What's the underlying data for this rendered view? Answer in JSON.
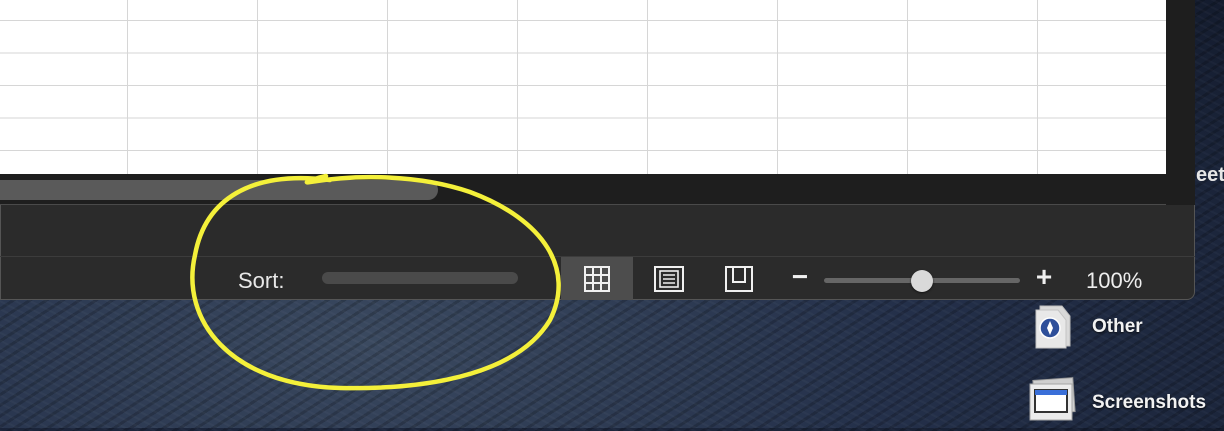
{
  "statusbar": {
    "sort_label": "Sort:",
    "view_buttons": [
      {
        "name": "normal-view",
        "icon": "grid-icon",
        "active": true
      },
      {
        "name": "page-layout-view",
        "icon": "page-layout-icon",
        "active": false
      },
      {
        "name": "page-break-view",
        "icon": "page-break-icon",
        "active": false
      }
    ],
    "zoom": {
      "minus_label": "−",
      "plus_label": "+",
      "value": "100%",
      "slider_level": 0.5
    }
  },
  "desktop": {
    "partial_label": "eet",
    "items": [
      {
        "label": "Other",
        "icon": "folder-badge-icon"
      },
      {
        "label": "Screenshots",
        "icon": "screenshot-stack-icon"
      }
    ]
  },
  "annotation": {
    "color": "#f4f03a"
  }
}
